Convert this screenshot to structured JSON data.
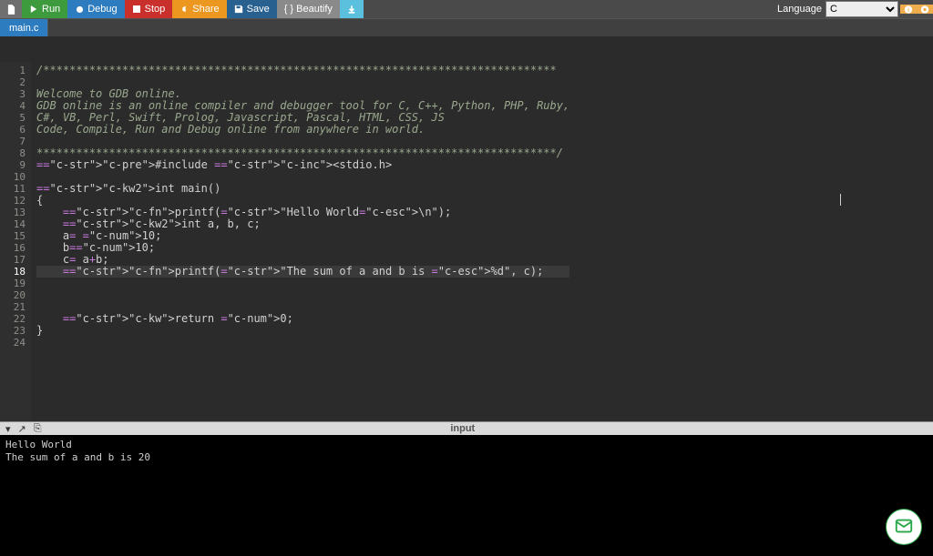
{
  "toolbar": {
    "run": "Run",
    "debug": "Debug",
    "stop": "Stop",
    "share": "Share",
    "save": "Save",
    "beautify": "{ } Beautify",
    "language_label": "Language",
    "language_value": "C"
  },
  "tab": {
    "filename": "main.c"
  },
  "code": {
    "lines": [
      "/******************************************************************************",
      "",
      "Welcome to GDB online.",
      "GDB online is an online compiler and debugger tool for C, C++, Python, PHP, Ruby,",
      "C#, VB, Perl, Swift, Prolog, Javascript, Pascal, HTML, CSS, JS",
      "Code, Compile, Run and Debug online from anywhere in world.",
      "",
      "*******************************************************************************/",
      "#include <stdio.h>",
      "",
      "int main()",
      "{",
      "    printf(\"Hello World\\n\");",
      "    int a, b, c;",
      "    a= 10;",
      "    b=10;",
      "    c= a+b;",
      "    printf(\"The sum of a and b is %d\", c);",
      "",
      "",
      "",
      "    return 0;",
      "}",
      ""
    ],
    "active_line": 18,
    "line_count": 24
  },
  "panel": {
    "label": "input"
  },
  "output": {
    "lines": [
      "Hello World",
      "The sum of a and b is 20"
    ]
  }
}
